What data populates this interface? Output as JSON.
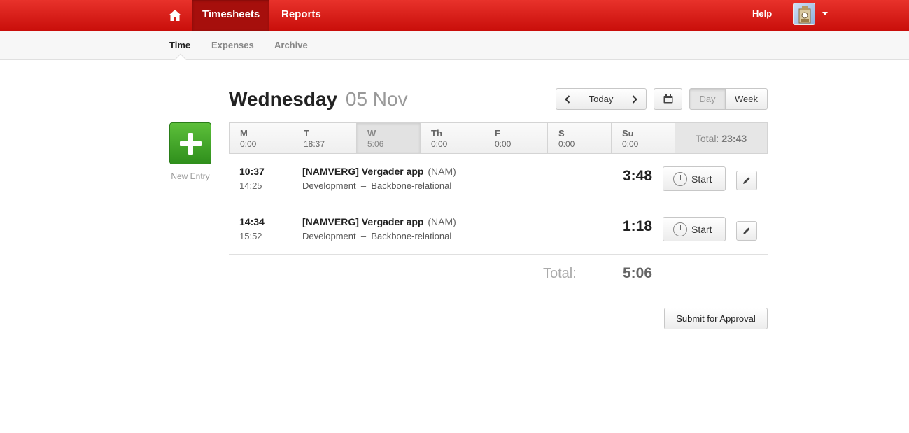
{
  "topnav": {
    "home_icon": "home-icon",
    "tabs": [
      {
        "label": "Timesheets",
        "active": true
      },
      {
        "label": "Reports",
        "active": false
      }
    ],
    "help_label": "Help",
    "avatar_icon": "user-avatar"
  },
  "subnav": {
    "tabs": [
      {
        "label": "Time",
        "active": true
      },
      {
        "label": "Expenses",
        "active": false
      },
      {
        "label": "Archive",
        "active": false
      }
    ]
  },
  "heading": {
    "day": "Wednesday",
    "date": "05 Nov"
  },
  "controls": {
    "prev_icon": "chevron-left-icon",
    "today_label": "Today",
    "next_icon": "chevron-right-icon",
    "calendar_icon": "calendar-icon",
    "view_day_label": "Day",
    "view_week_label": "Week",
    "selected_view": "Day"
  },
  "new_entry": {
    "label": "New Entry",
    "icon": "plus-icon",
    "color": "#3fa626"
  },
  "week": {
    "days": [
      {
        "label": "M",
        "time": "0:00"
      },
      {
        "label": "T",
        "time": "18:37"
      },
      {
        "label": "W",
        "time": "5:06",
        "active": true
      },
      {
        "label": "Th",
        "time": "0:00"
      },
      {
        "label": "F",
        "time": "0:00"
      },
      {
        "label": "S",
        "time": "0:00"
      },
      {
        "label": "Su",
        "time": "0:00"
      }
    ],
    "total_label": "Total:",
    "total_value": "23:43"
  },
  "entries": [
    {
      "start": "10:37",
      "end": "14:25",
      "project": "[NAMVERG] Vergader app",
      "code": "(NAM)",
      "task": "Development",
      "separator": "–",
      "subtask": "Backbone-relational",
      "duration": "3:48",
      "start_label": "Start"
    },
    {
      "start": "14:34",
      "end": "15:52",
      "project": "[NAMVERG] Vergader app",
      "code": "(NAM)",
      "task": "Development",
      "separator": "–",
      "subtask": "Backbone-relational",
      "duration": "1:18",
      "start_label": "Start"
    }
  ],
  "day_total": {
    "label": "Total:",
    "value": "5:06"
  },
  "submit_label": "Submit for Approval",
  "colors": {
    "brand": "#d8150f",
    "brand_dark": "#a60f0c"
  }
}
